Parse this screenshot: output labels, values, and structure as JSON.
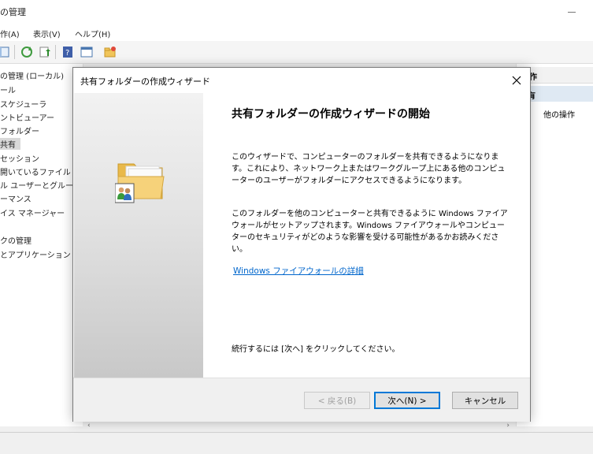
{
  "background": {
    "title": "の管理",
    "menu": [
      "作(A)",
      "表示(V)",
      "ヘルプ(H)"
    ],
    "tree": [
      {
        "label": "の管理 (ローカル)",
        "selected": false
      },
      {
        "label": "ール",
        "selected": false
      },
      {
        "label": "スケジューラ",
        "selected": false
      },
      {
        "label": "ントビューアー",
        "selected": false
      },
      {
        "label": "フォルダー",
        "selected": false
      },
      {
        "label": "共有",
        "selected": true
      },
      {
        "label": "セッション",
        "selected": false
      },
      {
        "label": "開いているファイル",
        "selected": false
      },
      {
        "label": "ル ユーザーとグループ",
        "selected": false
      },
      {
        "label": "ーマンス",
        "selected": false
      },
      {
        "label": "イス マネージャー",
        "selected": false
      },
      {
        "label": "",
        "selected": false
      },
      {
        "label": "クの管理",
        "selected": false
      },
      {
        "label": "とアプリケーション",
        "selected": false
      }
    ],
    "actions": {
      "header": "作",
      "selected": "有",
      "other": "他の操作"
    }
  },
  "dialog": {
    "title": "共有フォルダーの作成ウィザード",
    "heading": "共有フォルダーの作成ウィザードの開始",
    "para1": "このウィザードで、コンピューターのフォルダーを共有できるようになります。これにより、ネットワーク上またはワークグループ上にある他のコンピューターのユーザーがフォルダーにアクセスできるようになります。",
    "para2": "このフォルダーを他のコンピューターと共有できるように Windows ファイアウォールがセットアップされます。Windows ファイアウォールやコンピューターのセキュリティがどのような影響を受ける可能性があるかお読みください。",
    "link": "Windows ファイアウォールの詳細",
    "continue_text": "続行するには [次へ] をクリックしてください。",
    "buttons": {
      "back": "< 戻る(B)",
      "next": "次へ(N) >",
      "cancel": "キャンセル"
    }
  },
  "colors": {
    "link": "#0066cc",
    "default_button_border": "#0078d7",
    "selection": "#dfe9f3"
  }
}
